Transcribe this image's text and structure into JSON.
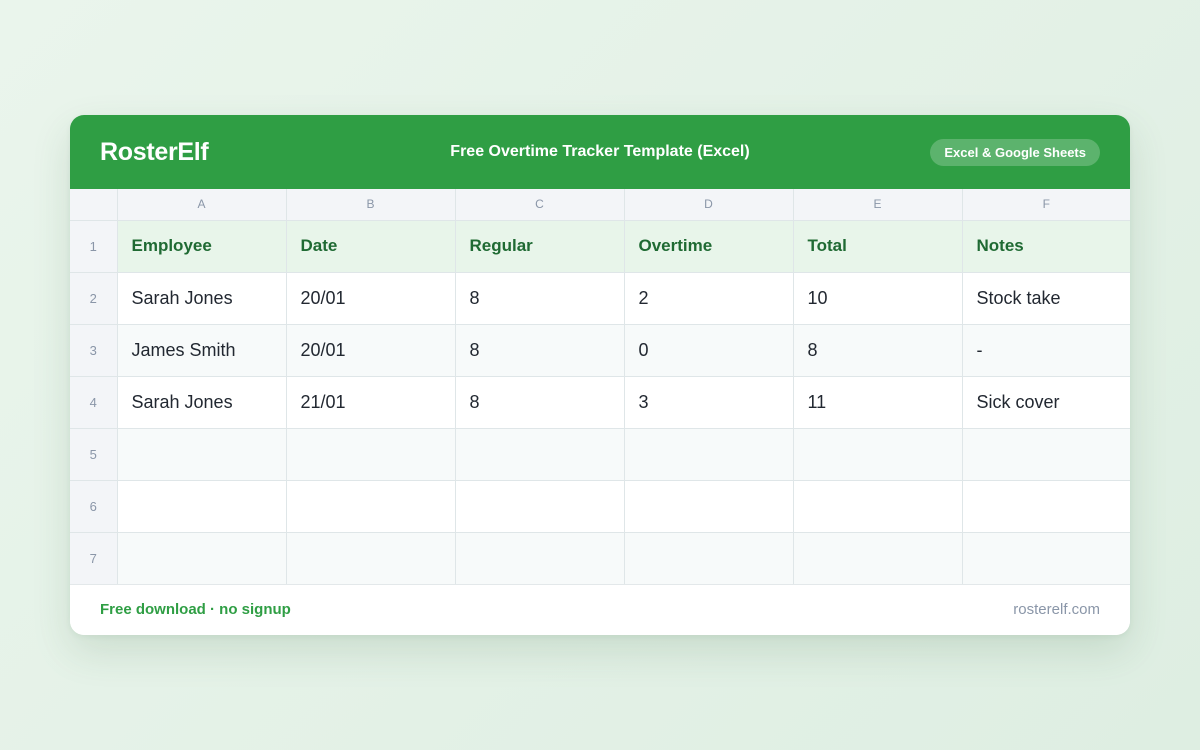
{
  "header": {
    "logo": "RosterElf",
    "title": "Free Overtime Tracker Template (Excel)",
    "badge": "Excel & Google Sheets"
  },
  "sheet": {
    "column_letters": [
      "A",
      "B",
      "C",
      "D",
      "E",
      "F"
    ],
    "row_numbers": [
      "1",
      "2",
      "3",
      "4",
      "5",
      "6",
      "7"
    ],
    "header_cells": [
      "Employee",
      "Date",
      "Regular",
      "Overtime",
      "Total",
      "Notes"
    ],
    "rows": [
      [
        "Sarah Jones",
        "20/01",
        "8",
        "2",
        "10",
        "Stock take"
      ],
      [
        "James Smith",
        "20/01",
        "8",
        "0",
        "8",
        "-"
      ],
      [
        "Sarah Jones",
        "21/01",
        "8",
        "3",
        "11",
        "Sick cover"
      ],
      [
        "",
        "",
        "",
        "",
        "",
        ""
      ],
      [
        "",
        "",
        "",
        "",
        "",
        ""
      ],
      [
        "",
        "",
        "",
        "",
        "",
        ""
      ]
    ]
  },
  "footer": {
    "left": "Free download · no signup",
    "right": "rosterelf.com"
  },
  "colors": {
    "brand_green": "#2f9e44",
    "header_text_green": "#1f6a33",
    "header_row_bg": "#e8f5ea"
  }
}
